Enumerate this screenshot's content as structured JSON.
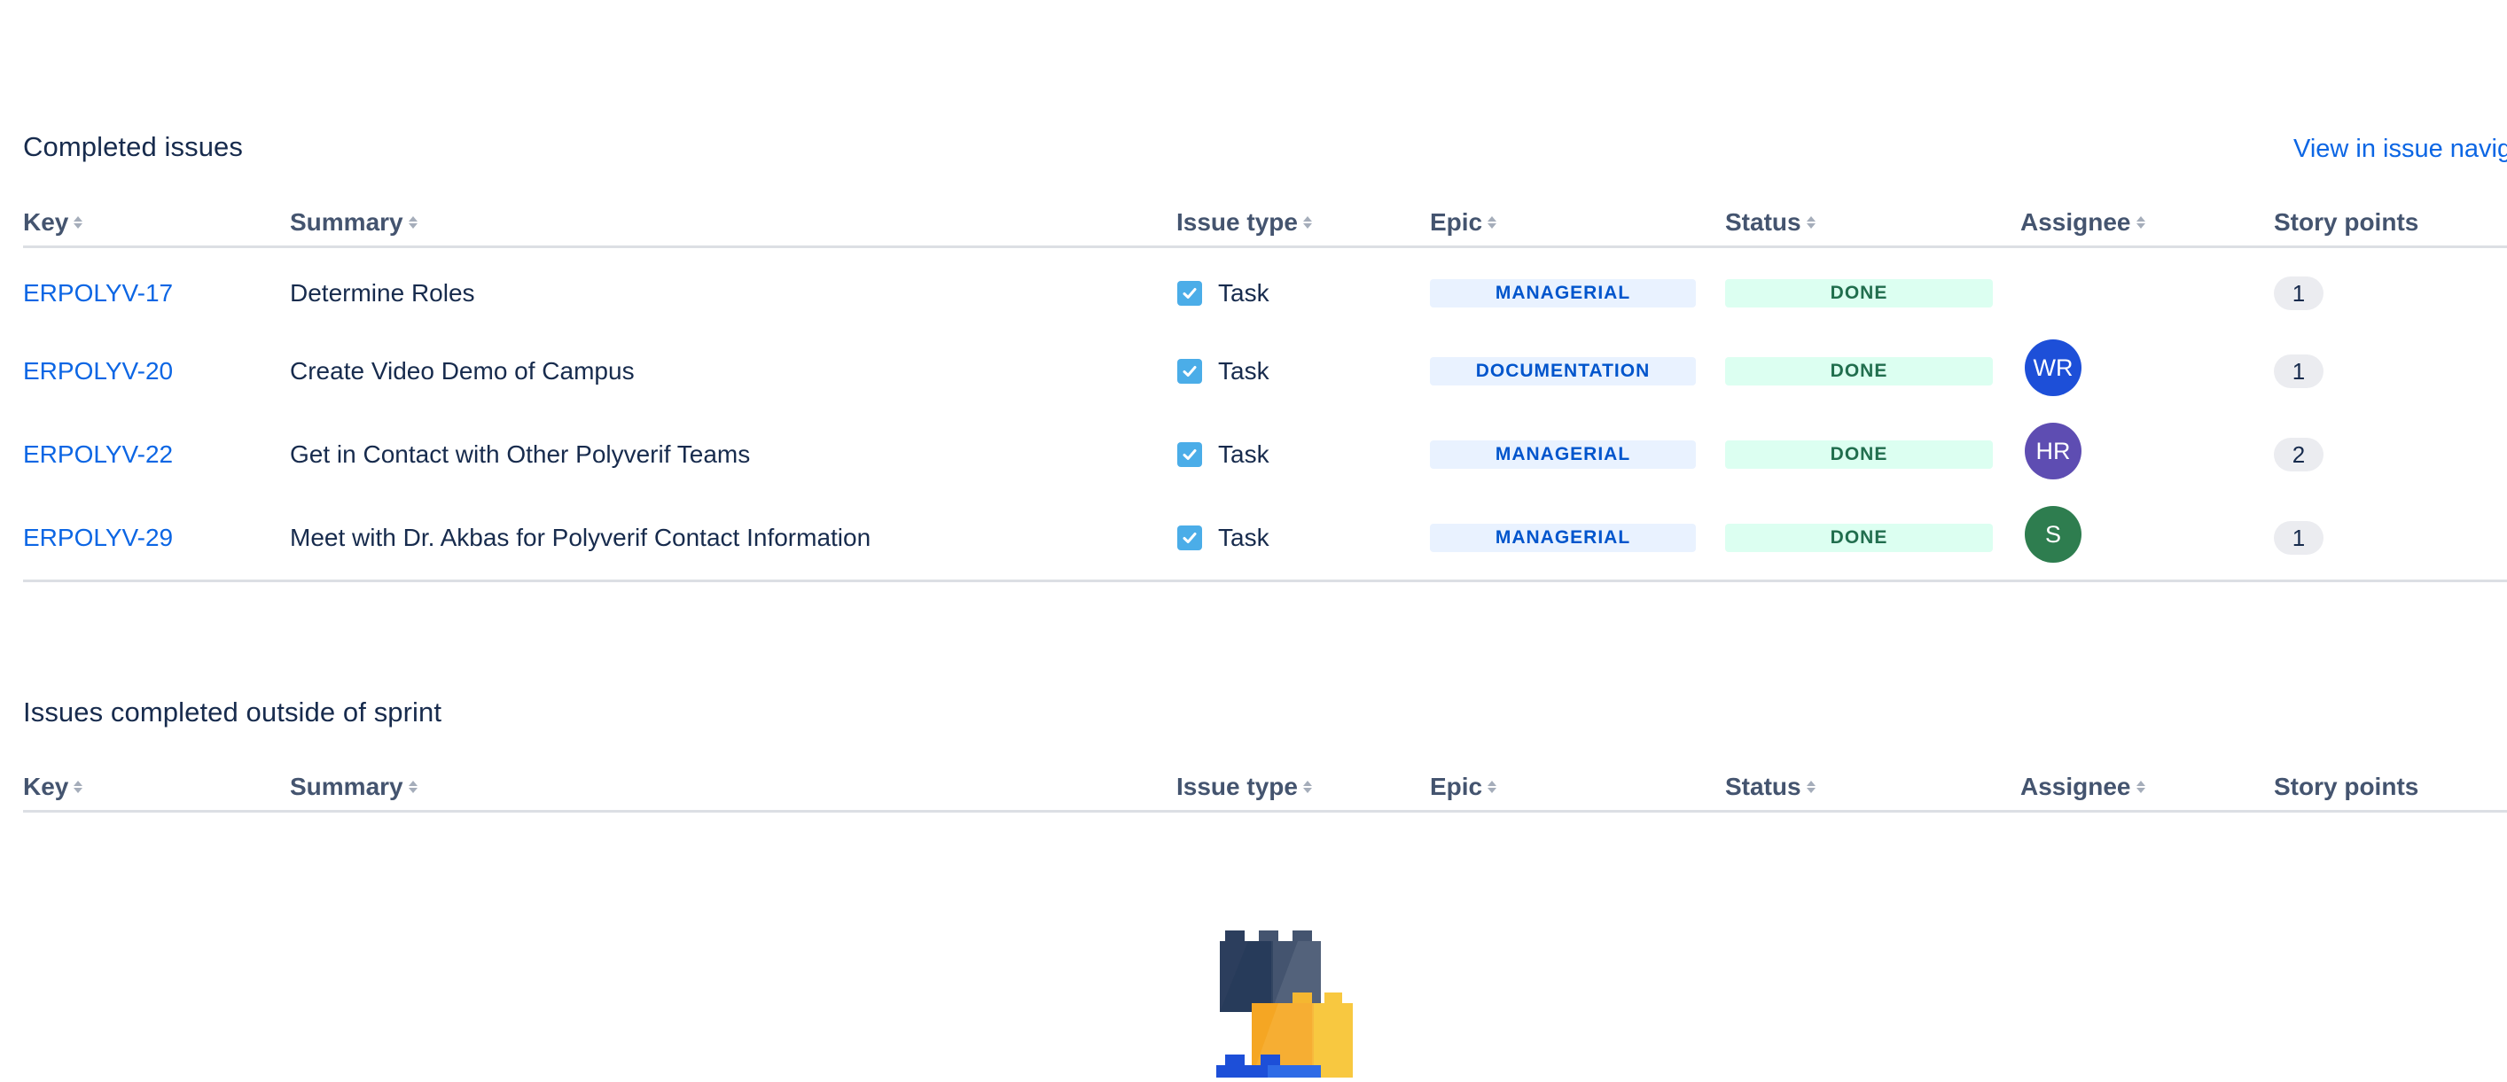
{
  "completed": {
    "title": "Completed issues",
    "view_link": "View in issue navig",
    "columns": {
      "key": "Key",
      "summary": "Summary",
      "issue_type": "Issue type",
      "epic": "Epic",
      "status": "Status",
      "assignee": "Assignee",
      "story_points": "Story points"
    },
    "rows": [
      {
        "key": "ERPOLYV-17",
        "summary": "Determine Roles",
        "type": "Task",
        "epic": "MANAGERIAL",
        "status": "DONE",
        "assignee": "",
        "points": "1"
      },
      {
        "key": "ERPOLYV-20",
        "summary": "Create Video Demo of Campus",
        "type": "Task",
        "epic": "DOCUMENTATION",
        "status": "DONE",
        "assignee": "WR",
        "points": "1"
      },
      {
        "key": "ERPOLYV-22",
        "summary": "Get in Contact with Other Polyverif Teams",
        "type": "Task",
        "epic": "MANAGERIAL",
        "status": "DONE",
        "assignee": "HR",
        "points": "2"
      },
      {
        "key": "ERPOLYV-29",
        "summary": "Meet with Dr. Akbas for Polyverif Contact Information",
        "type": "Task",
        "epic": "MANAGERIAL",
        "status": "DONE",
        "assignee": "S",
        "points": "1"
      }
    ]
  },
  "outside": {
    "title": "Issues completed outside of sprint",
    "columns": {
      "key": "Key",
      "summary": "Summary",
      "issue_type": "Issue type",
      "epic": "Epic",
      "status": "Status",
      "assignee": "Assignee",
      "story_points": "Story points"
    }
  },
  "icons": {
    "task": "checkbox-task-icon",
    "sort": "sort-arrows-icon",
    "empty": "building-blocks-illustration"
  },
  "colors": {
    "link": "#0c66e4",
    "task_icon": "#4bade8",
    "epic_bg": "#e9f2ff",
    "epic_text": "#0055cc",
    "status_bg": "#dcfff1",
    "status_text": "#216e4e",
    "avatar_wr": "#1d4fd8",
    "avatar_hr": "#5e4db2",
    "avatar_s": "#2e7d4f"
  }
}
